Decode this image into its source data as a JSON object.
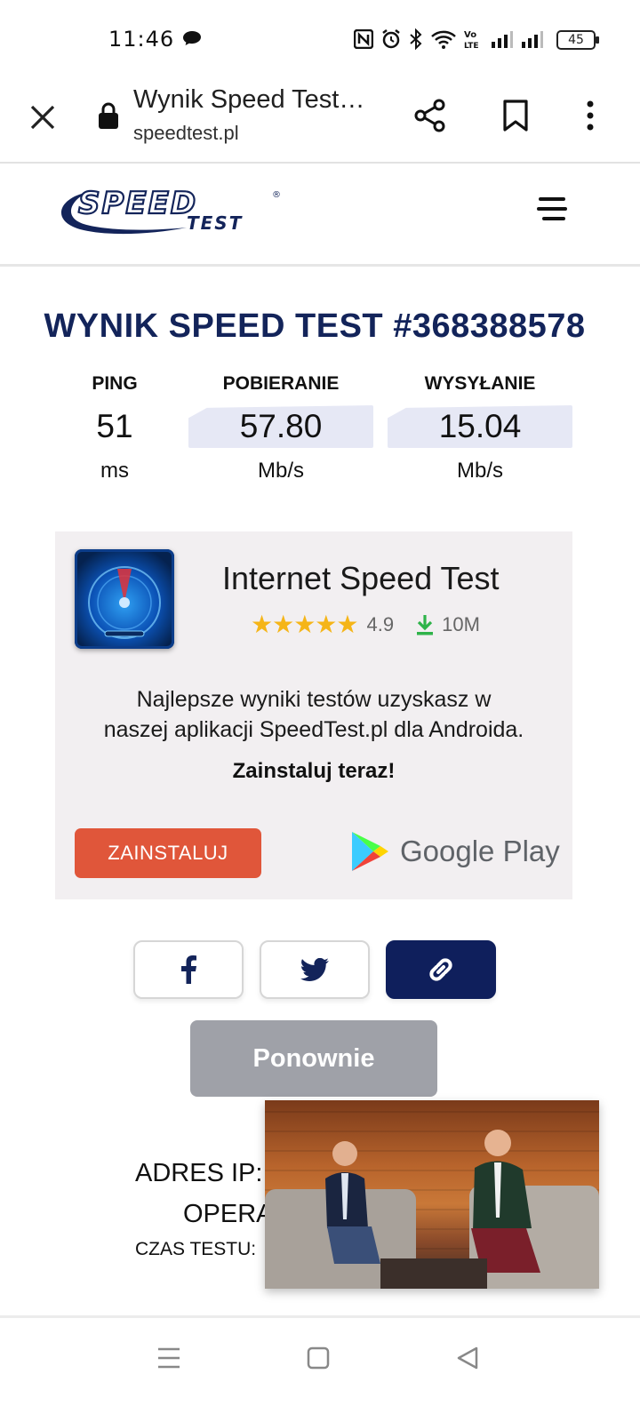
{
  "status_bar": {
    "time": "11:46",
    "battery": "45"
  },
  "browser": {
    "page_title": "Wynik Speed Test…",
    "domain": "speedtest.pl"
  },
  "site": {
    "logo_text": "SPEED TEST"
  },
  "result": {
    "title": "WYNIK SPEED TEST #368388578",
    "metrics": [
      {
        "label": "PING",
        "value": "51",
        "unit": "ms"
      },
      {
        "label": "POBIERANIE",
        "value": "57.80",
        "unit": "Mb/s"
      },
      {
        "label": "WYSYŁANIE",
        "value": "15.04",
        "unit": "Mb/s"
      }
    ]
  },
  "ad": {
    "app_name": "Internet Speed Test",
    "rating": "4.9",
    "downloads": "10M",
    "description_line1": "Najlepsze wyniki testów uzyskasz w",
    "description_line2": "naszej aplikacji SpeedTest.pl dla Androida.",
    "cta": "Zainstaluj teraz!",
    "install_label": "ZAINSTALUJ",
    "store_label": "Google Play"
  },
  "actions": {
    "again_label": "Ponownie"
  },
  "details": {
    "ip_label": "ADRES IP:",
    "operator_label": "OPERA",
    "time_label": "CZAS TESTU:"
  },
  "colors": {
    "navy": "#13245a",
    "install": "#e0563a",
    "again": "#9fa1a8",
    "metric_bg": "#e6e8f5"
  }
}
